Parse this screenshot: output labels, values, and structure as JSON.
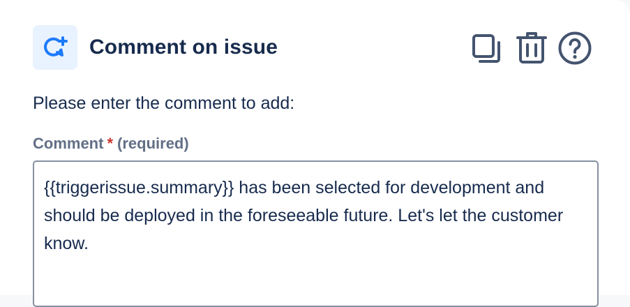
{
  "header": {
    "title": "Comment on issue",
    "action_icon": "comment-add-icon",
    "tools": [
      {
        "name": "copy",
        "icon": "copy-icon"
      },
      {
        "name": "delete",
        "icon": "trash-icon"
      },
      {
        "name": "help",
        "icon": "question-circle-icon"
      }
    ]
  },
  "form": {
    "intro": "Please enter the comment to add:",
    "comment_label": "Comment",
    "required_star": "*",
    "required_text": "(required)",
    "comment_value": "{{triggerissue.summary}} has been selected for development and should be deployed in the foreseeable future. Let's let the customer know."
  },
  "colors": {
    "text_primary": "#172b4d",
    "text_subtle": "#626f86",
    "accent_blue": "#1d7afc",
    "icon_tile_bg": "#e9f2ff",
    "required_red": "#c9372c",
    "icon_gray": "#44546f",
    "border": "#8590a2"
  }
}
